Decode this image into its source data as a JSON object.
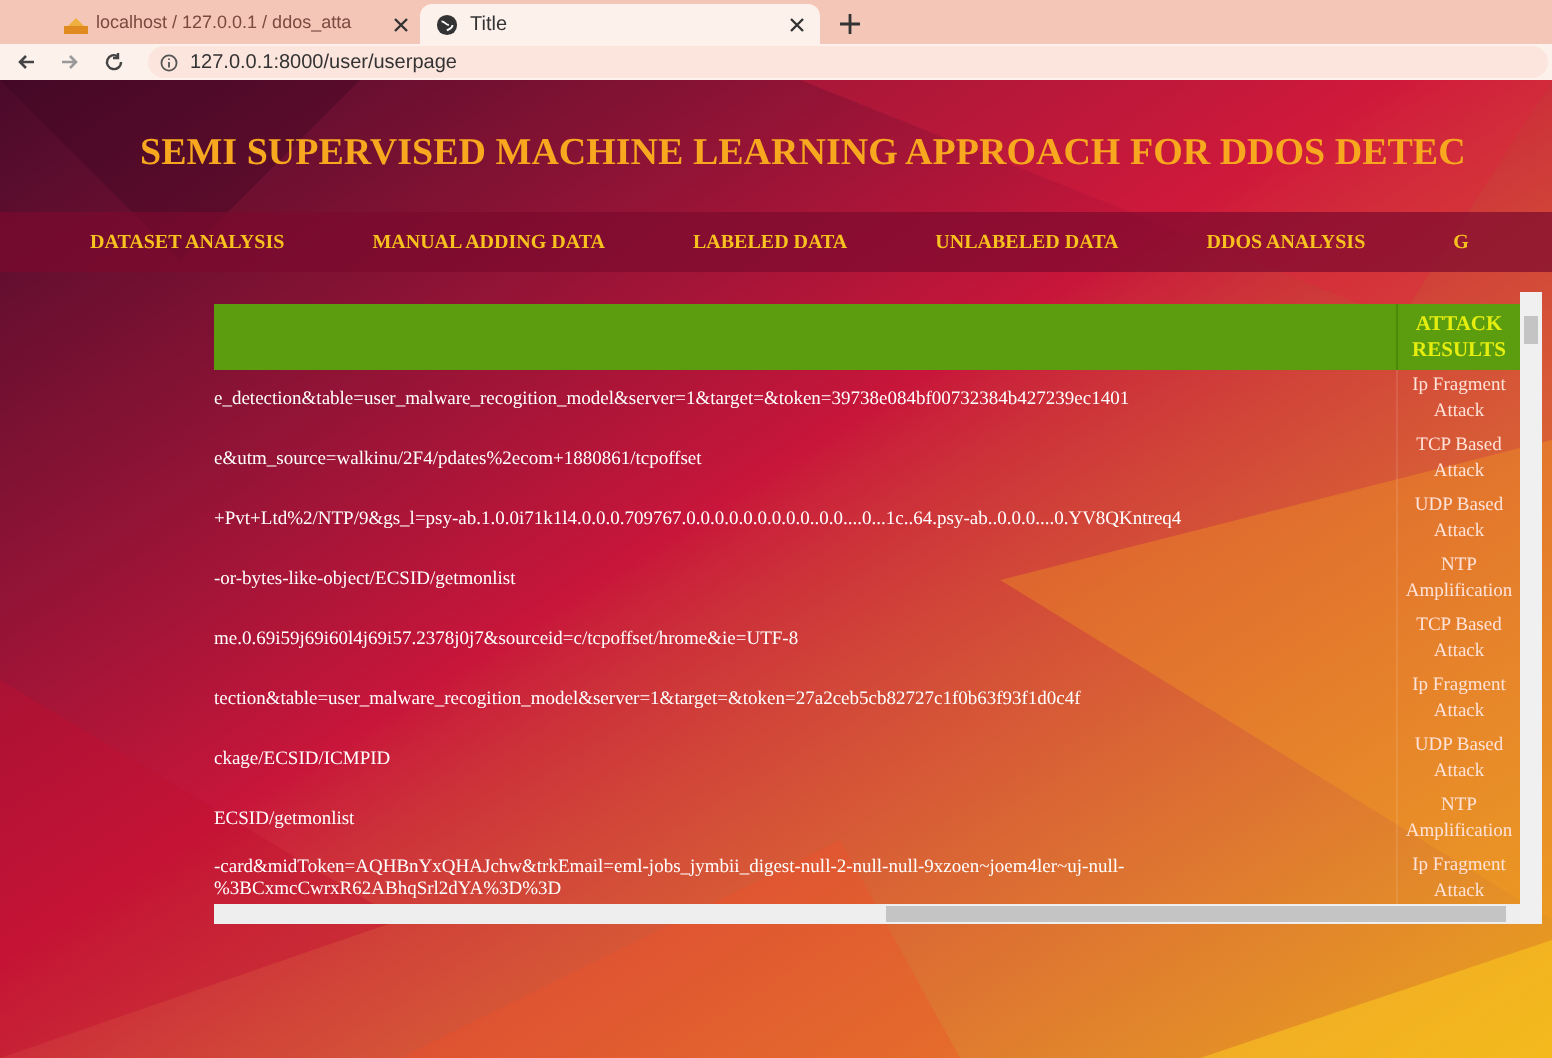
{
  "browser": {
    "tabs": [
      {
        "title": "localhost / 127.0.0.1 / ddos_atta",
        "selected": false,
        "kind": "db"
      },
      {
        "title": "Title",
        "selected": true,
        "kind": "globe"
      }
    ],
    "url": "127.0.0.1:8000/user/userpage"
  },
  "page": {
    "title": "SEMI SUPERVISED MACHINE LEARNING APPROACH FOR DDOS DETEC",
    "nav": [
      "DATASET ANALYSIS",
      "MANUAL ADDING DATA",
      "LABELED DATA",
      "UNLABELED DATA",
      "DDOS ANALYSIS",
      "G"
    ],
    "table": {
      "columns": [
        "ATTACK RESULTS"
      ],
      "rows": [
        {
          "url": "e_detection&table=user_malware_recogition_model&server=1&target=&token=39738e084bf00732384b427239ec1401",
          "result": "Ip Fragment Attack"
        },
        {
          "url": "e&utm_source=walkinu/2F4/pdates%2ecom+1880861/tcpoffset",
          "result": "TCP Based Attack"
        },
        {
          "url": "+Pvt+Ltd%2/NTP/9&gs_l=psy-ab.1.0.0i71k1l4.0.0.0.709767.0.0.0.0.0.0.0.0.0..0.0....0...1c..64.psy-ab..0.0.0....0.YV8QKntreq4",
          "result": "UDP Based Attack"
        },
        {
          "url": "-or-bytes-like-object/ECSID/getmonlist",
          "result": "NTP Amplification"
        },
        {
          "url": "me.0.69i59j69i60l4j69i57.2378j0j7&sourceid=c/tcpoffset/hrome&ie=UTF-8",
          "result": "TCP Based Attack"
        },
        {
          "url": "tection&table=user_malware_recogition_model&server=1&target=&token=27a2ceb5cb82727c1f0b63f93f1d0c4f",
          "result": "Ip Fragment Attack"
        },
        {
          "url": "ckage/ECSID/ICMPID",
          "result": "UDP Based Attack"
        },
        {
          "url": "ECSID/getmonlist",
          "result": "NTP Amplification"
        },
        {
          "url": "-card&midToken=AQHBnYxQHAJchw&trkEmail=eml-jobs_jymbii_digest-null-2-null-null-9xzoen~joem4ler~uj-null-\n%3BCxmcCwrxR62ABhqSrl2dYA%3D%3D",
          "result": "Ip Fragment Attack"
        }
      ]
    }
  }
}
